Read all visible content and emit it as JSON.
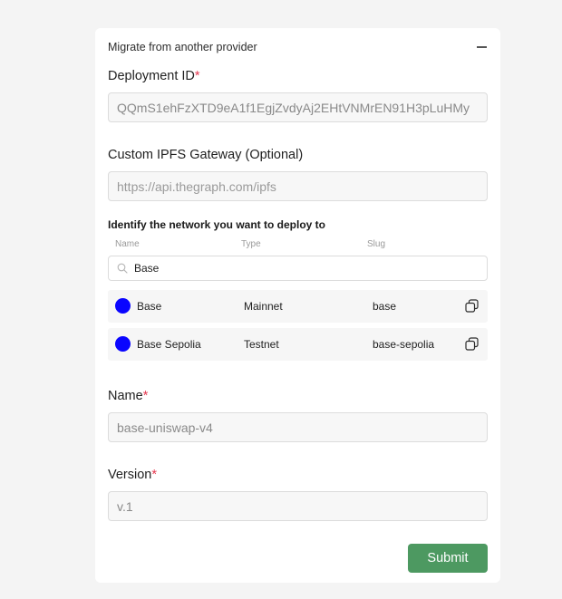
{
  "card": {
    "title": "Migrate from another provider",
    "collapse_icon": "minus-icon"
  },
  "deployment_id": {
    "label": "Deployment ID",
    "required_mark": "*",
    "value": "QQmS1ehFzXTD9eA1f1EgjZvdyAj2EHtVNMrEN91H3pLuHMy"
  },
  "ipfs_gateway": {
    "label": "Custom IPFS Gateway (Optional)",
    "placeholder": "https://api.thegraph.com/ipfs"
  },
  "network": {
    "heading": "Identify the network you want to deploy to",
    "columns": [
      "Name",
      "Type",
      "Slug"
    ],
    "search_value": "Base",
    "search_icon": "search-icon",
    "rows": [
      {
        "name": "Base",
        "type": "Mainnet",
        "slug": "base",
        "dot_color": "#0a05ff",
        "copy_icon": "copy-icon"
      },
      {
        "name": "Base Sepolia",
        "type": "Testnet",
        "slug": "base-sepolia",
        "dot_color": "#0a05ff",
        "copy_icon": "copy-icon"
      }
    ]
  },
  "name_field": {
    "label": "Name",
    "required_mark": "*",
    "value": "base-uniswap-v4"
  },
  "version_field": {
    "label": "Version",
    "required_mark": "*",
    "value": "v.1"
  },
  "submit": {
    "label": "Submit",
    "color": "#4d9961"
  },
  "colors": {
    "background": "#f4f4f4",
    "required": "#e53950"
  }
}
